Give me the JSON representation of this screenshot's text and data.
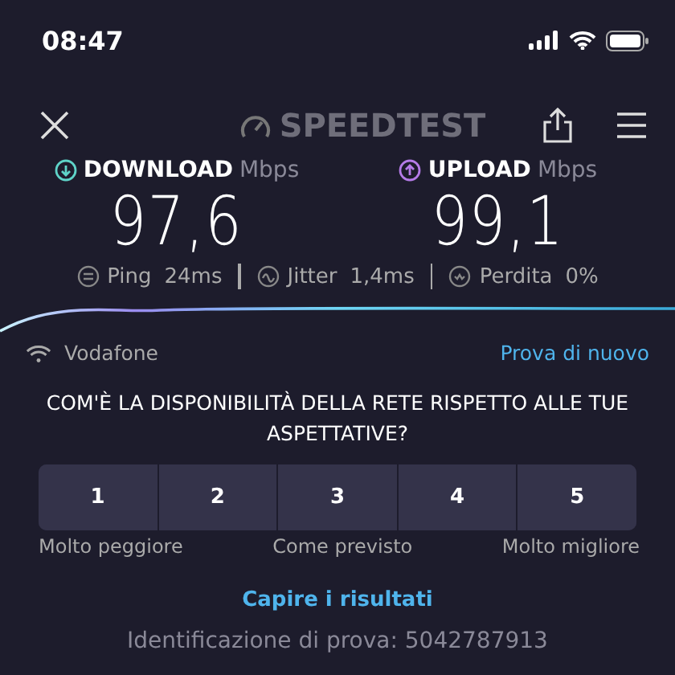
{
  "status_bar": {
    "time": "08:47"
  },
  "header": {
    "logo": "SPEEDTEST"
  },
  "results": [
    {
      "kind": "download",
      "label": "DOWNLOAD",
      "unit": "Mbps",
      "value": "97,6",
      "color": "#5fd3c8"
    },
    {
      "kind": "upload",
      "label": "UPLOAD",
      "unit": "Mbps",
      "value": "99,1",
      "color": "#b57be8"
    }
  ],
  "stats": [
    {
      "kind": "ping",
      "label": "Ping",
      "value": "24ms"
    },
    {
      "kind": "jitter",
      "label": "Jitter",
      "value": "1,4ms"
    },
    {
      "kind": "loss",
      "label": "Perdita",
      "value": "0%"
    }
  ],
  "network": {
    "name": "Vodafone",
    "retry": "Prova di nuovo"
  },
  "survey": {
    "question": "COM'È LA DISPONIBILITÀ DELLA RETE RISPETTO ALLE TUE ASPETTATIVE?",
    "options": [
      "1",
      "2",
      "3",
      "4",
      "5"
    ],
    "scale_labels": [
      "Molto peggiore",
      "Come previsto",
      "Molto migliore"
    ]
  },
  "link": "Capire i risultati",
  "test_id": "Identificazione di prova: 5042787913"
}
